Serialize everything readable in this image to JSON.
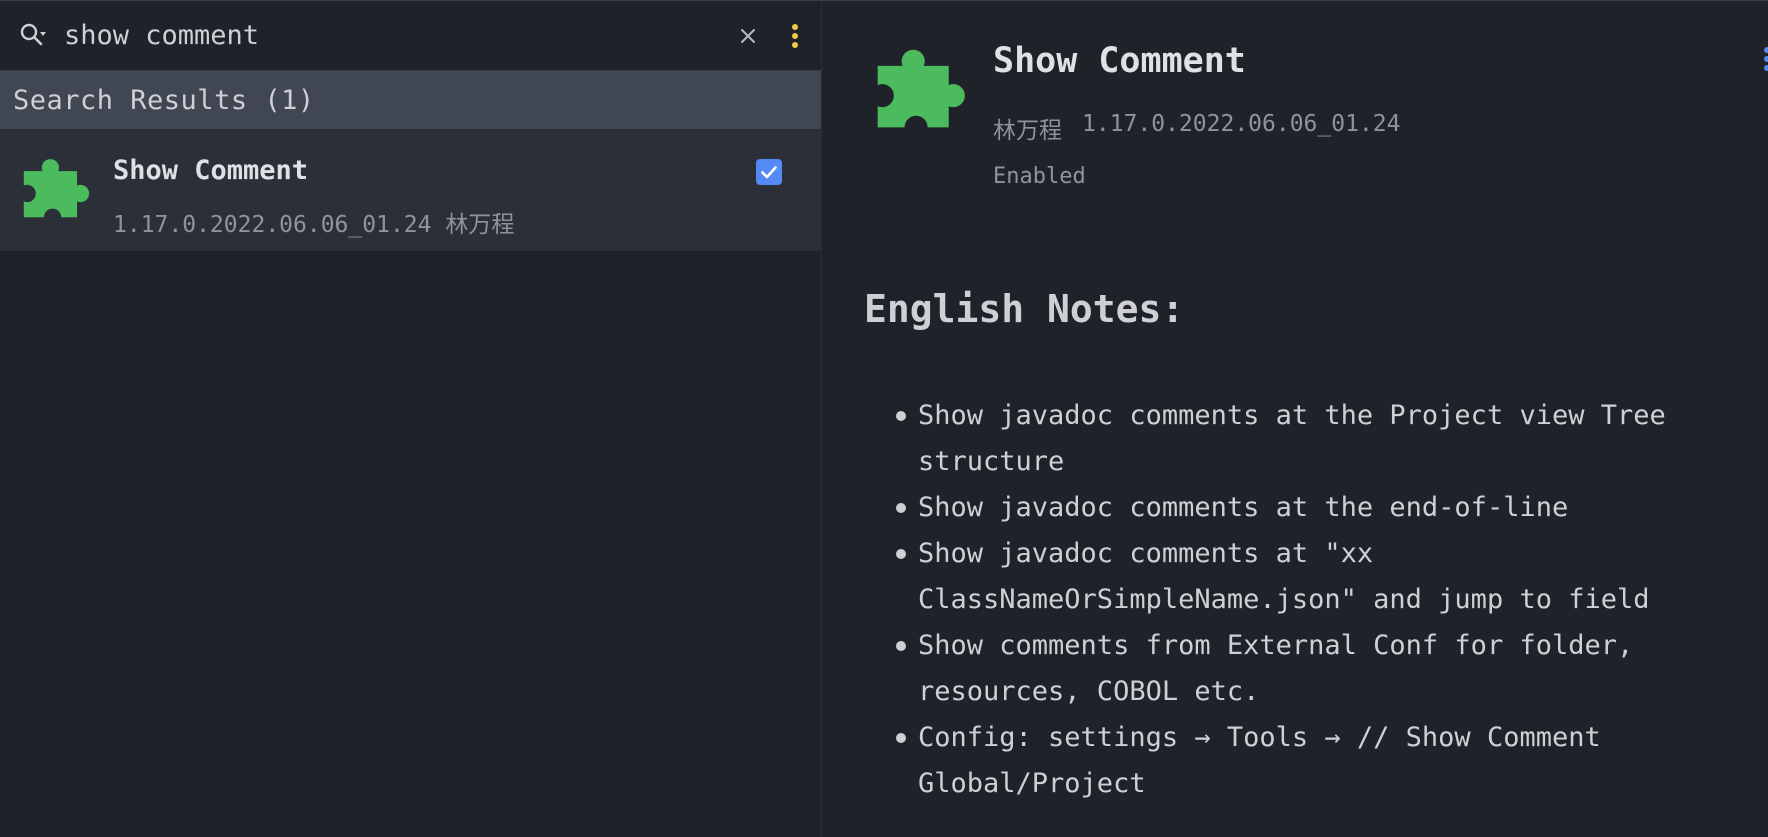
{
  "search": {
    "value": "show comment",
    "placeholder": ""
  },
  "results": {
    "header": "Search Results (1)",
    "items": [
      {
        "name": "Show Comment",
        "meta": "1.17.0.2022.06.06_01.24 林万程",
        "checked": true
      }
    ]
  },
  "detail": {
    "title": "Show Comment",
    "author": "林万程",
    "version": "1.17.0.2022.06.06_01.24",
    "status": "Enabled",
    "notes_heading": "English Notes:",
    "notes": [
      "Show javadoc comments at the Project view Tree structure",
      "Show javadoc comments at the end-of-line",
      "Show javadoc comments at \"xx ClassNameOrSimpleName.json\" and jump to field",
      "Show comments from External Conf for folder, resources, COBOL etc.",
      "Config: settings → Tools → // Show Comment Global/Project"
    ]
  },
  "colors": {
    "background": "#1f2329",
    "selected_row": "#2b2f38",
    "section_header": "#404652",
    "plugin_green": "#4cbb5e",
    "checkbox_blue": "#548af7",
    "more_yellow": "#f2c94c"
  },
  "icons": {
    "search": "search-history-icon",
    "clear": "close-icon",
    "more": "more-vertical-icon",
    "plugin": "puzzle-piece-icon",
    "check": "checkmark-icon"
  }
}
